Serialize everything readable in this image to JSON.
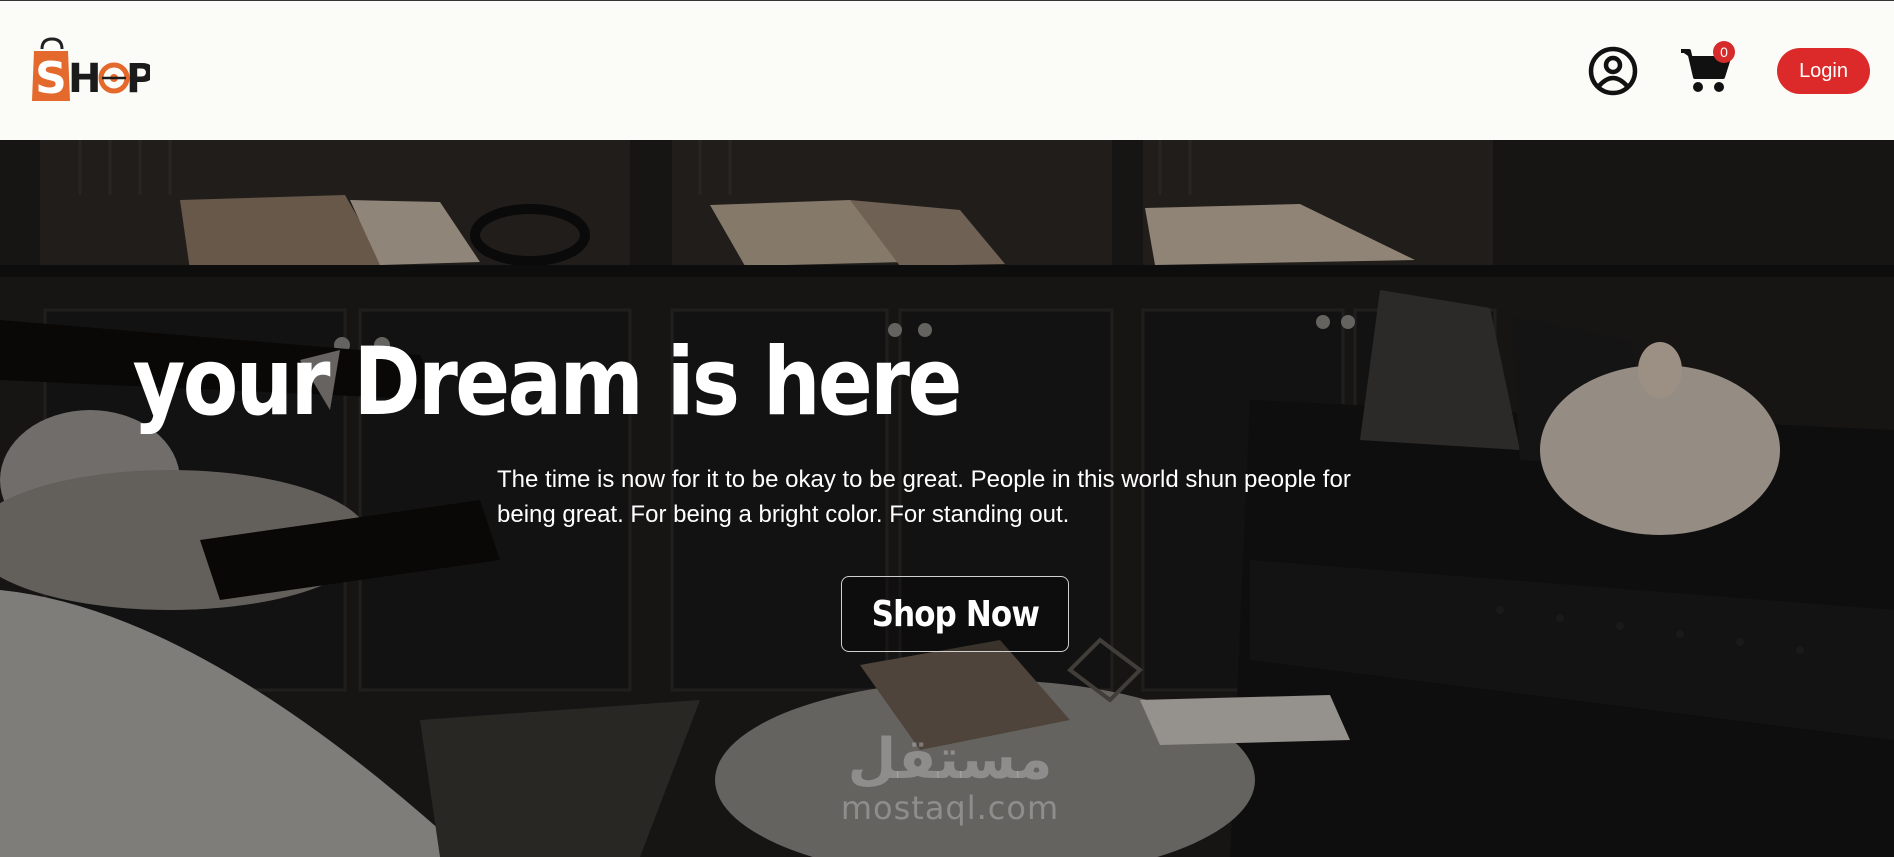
{
  "header": {
    "logo_text": "SHOP",
    "login_label": "Login",
    "cart_count": "0",
    "icons": {
      "account": "account-circle-icon",
      "cart": "shopping-cart-icon"
    },
    "colors": {
      "background": "#fbfbf8",
      "accent": "#dc2a2a",
      "logo_orange": "#e36a2c"
    }
  },
  "hero": {
    "title": "your Dream is here",
    "description": "The time is now for it to be okay to be great. People in this world shun people for being great. For being a bright color. For standing out.",
    "cta_label": "Shop Now"
  },
  "watermark": {
    "arabic": "مستقل",
    "latin": "mostaql.com"
  }
}
